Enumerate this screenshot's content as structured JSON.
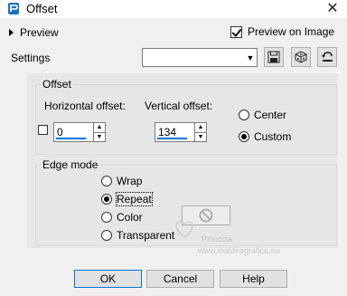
{
  "window": {
    "title": "Offset"
  },
  "preview": {
    "toggle_label": "Preview",
    "on_image_label": "Preview on Image",
    "on_image_checked": true
  },
  "settings": {
    "label": "Settings",
    "selected": ""
  },
  "offset": {
    "group_label": "Offset",
    "horizontal": {
      "label": "Horizontal offset:",
      "value": "0"
    },
    "vertical": {
      "label": "Vertical offset:",
      "value": "134"
    },
    "options": [
      "Center",
      "Custom"
    ],
    "selected": "Custom"
  },
  "edge_mode": {
    "group_label": "Edge mode",
    "options": [
      "Wrap",
      "Repeat",
      "Color",
      "Transparent"
    ],
    "selected": "Repeat"
  },
  "buttons": {
    "ok": "OK",
    "cancel": "Cancel",
    "help": "Help"
  },
  "watermark": {
    "name": "Pinuccia",
    "site": "www.maldiregrafica.eu"
  }
}
